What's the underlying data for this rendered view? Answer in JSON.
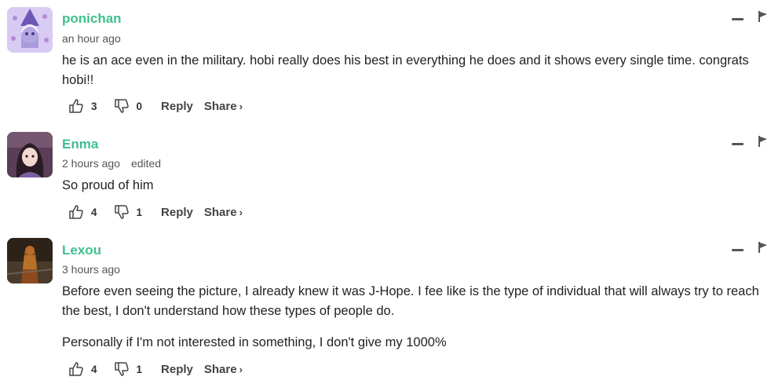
{
  "comments": [
    {
      "username": "ponichan",
      "time": "an hour ago",
      "edited": "",
      "paragraphs": [
        "he is an ace even in the military. hobi really does his best in everything he does and it shows every single time. congrats hobi!!"
      ],
      "likes": "3",
      "dislikes": "0",
      "avatar_color": "#c9b8ef",
      "reply_label": "Reply",
      "share_label": "Share",
      "share_chevron": "›"
    },
    {
      "username": "Enma",
      "time": "2 hours ago",
      "edited": "edited",
      "paragraphs": [
        "So proud of him"
      ],
      "likes": "4",
      "dislikes": "1",
      "avatar_color": "#6b4a63",
      "reply_label": "Reply",
      "share_label": "Share",
      "share_chevron": "›"
    },
    {
      "username": "Lexou",
      "time": "3 hours ago",
      "edited": "",
      "paragraphs": [
        "Before even seeing the picture, I already knew it was J-Hope. I fee like is the type of individual that will always try to reach the best, I don't understand how these types of people do.",
        "Personally if I'm not interested in something, I don't give my 1000%"
      ],
      "likes": "4",
      "dislikes": "1",
      "avatar_color": "#3a2a1a",
      "reply_label": "Reply",
      "share_label": "Share",
      "share_chevron": "›"
    }
  ],
  "colors": {
    "username": "#3fbf8f",
    "text": "#222222",
    "meta": "#555555"
  },
  "icons": {
    "like": "thumbs-up-icon",
    "dislike": "thumbs-down-icon",
    "collapse": "minus-icon",
    "flag": "flag-icon"
  }
}
